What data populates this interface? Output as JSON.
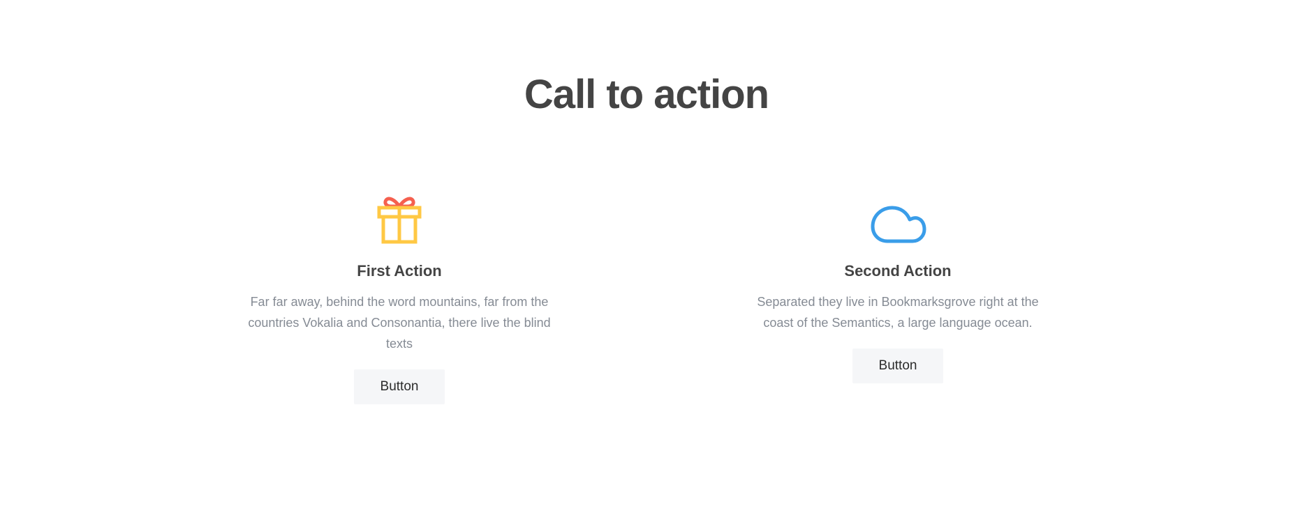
{
  "section": {
    "title": "Call to action"
  },
  "cards": [
    {
      "icon": "gift-icon",
      "title": "First Action",
      "text": "Far far away, behind the word mountains, far from the countries Vokalia and Consonantia, there live the blind texts",
      "button_label": "Button"
    },
    {
      "icon": "cloud-icon",
      "title": "Second Action",
      "text": "Separated they live in Bookmarksgrove right at the coast of the Semantics, a large language ocean.",
      "button_label": "Button"
    }
  ],
  "colors": {
    "gift_box": "#ffc844",
    "gift_ribbon": "#f5604f",
    "cloud": "#3a9de9",
    "heading": "#444444",
    "body_text": "#858b94",
    "button_bg": "#f5f6f8"
  }
}
